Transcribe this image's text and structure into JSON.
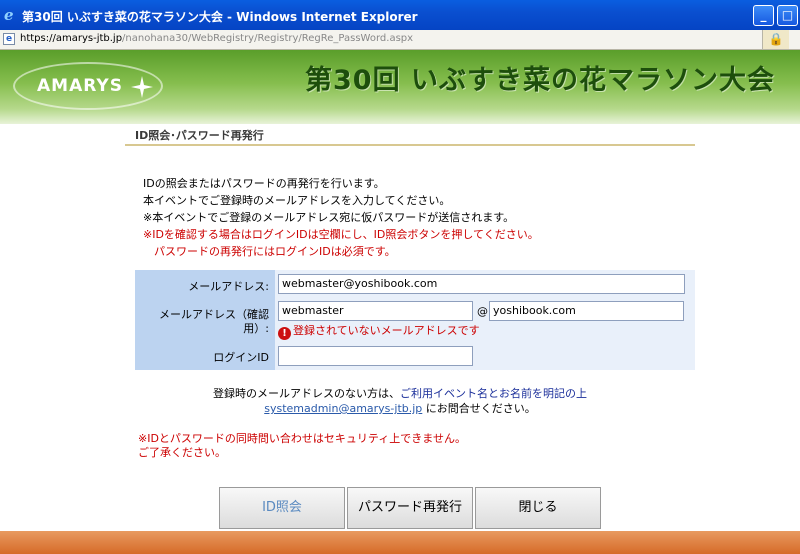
{
  "window": {
    "title": "第30回 いぶすき菜の花マラソン大会 - Windows Internet Explorer",
    "icon": "ie-icon",
    "controls": [
      "minimize",
      "maximize"
    ]
  },
  "address_bar": {
    "host": "https://amarys-jtb.jp",
    "path": "/nanohana30/WebRegistry/Registry/RegRe_PassWord.aspx"
  },
  "banner": {
    "logo_text": "AMARYS",
    "headline": "第30回 いぶすき菜の花マラソン大会"
  },
  "section_title": "ID照会･パスワード再発行",
  "intro": {
    "lines": [
      "IDの照会またはパスワードの再発行を行います。",
      "本イベントでご登録時のメールアドレスを入力してください。",
      "※本イベントでご登録のメールアドレス宛に仮パスワードが送信されます。"
    ],
    "warnings": [
      "※IDを確認する場合はログインIDは空欄にし、ID照会ボタンを押してください。",
      "　パスワードの再発行にはログインIDは必須です。"
    ]
  },
  "form": {
    "email_label": "メールアドレス:",
    "email_value": "webmaster@yoshibook.com",
    "confirm_label_1": "メールアドレス（確認",
    "confirm_label_2": "用）:",
    "confirm_local": "webmaster",
    "at_sign": "@",
    "confirm_domain": "yoshibook.com",
    "error_message": "登録されていないメールアドレスです",
    "login_label": "ログインID",
    "login_value": ""
  },
  "contact": {
    "line1_prefix": "登録時のメールアドレスのない方は、",
    "line1_highlight": "ご利用イベント名とお名前を明記の上",
    "email_link": "systemadmin@amarys-jtb.jp",
    "line2_suffix": " にお問合せください。"
  },
  "note_lines": [
    "※IDとパスワードの同時問い合わせはセキュリティ上できません。",
    "ご了承ください。"
  ],
  "buttons": {
    "id_inquiry": "ID照会",
    "reissue_password": "パスワード再発行",
    "close": "閉じる"
  },
  "colors": {
    "titlebar": "#0a4fd0",
    "banner_green": "#86be4e",
    "headline": "#1d4e0c",
    "form_label_bg": "#bcd3f0",
    "form_bg": "#e9f0fa",
    "warning_red": "#cc0000",
    "footer": "#d66a28"
  }
}
